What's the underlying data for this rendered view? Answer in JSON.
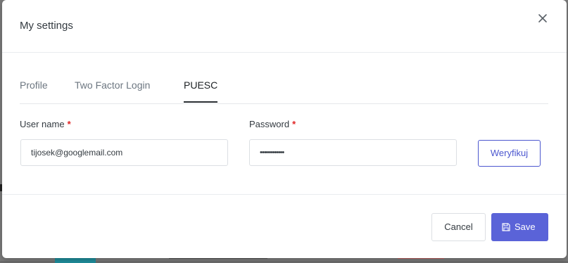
{
  "modal": {
    "title": "My settings"
  },
  "tabs": [
    {
      "label": "Profile",
      "active": false
    },
    {
      "label": "Two Factor Login",
      "active": false
    },
    {
      "label": "PUESC",
      "active": true
    }
  ],
  "form": {
    "username": {
      "label": "User name",
      "required_mark": "*",
      "value": "tijosek@googlemail.com"
    },
    "password": {
      "label": "Password",
      "required_mark": "*",
      "value": "••••••••••••"
    },
    "verify_button": "Weryfikuj"
  },
  "footer": {
    "cancel_label": "Cancel",
    "save_label": "Save"
  },
  "icons": {
    "close": "close-icon",
    "save": "floppy-disk-icon"
  },
  "colors": {
    "primary": "#5a63d8",
    "required": "#e02424"
  }
}
